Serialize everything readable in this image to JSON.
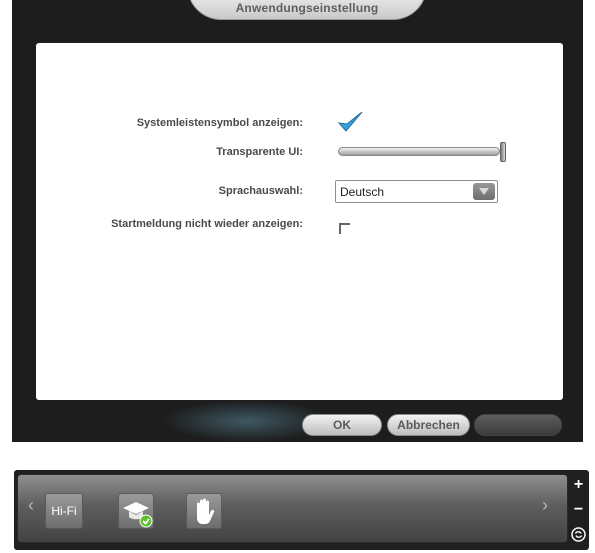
{
  "dialog": {
    "title": "Anwendungseinstellung",
    "settings": {
      "tray_icon_label": "Systemleistensymbol anzeigen:",
      "tray_icon_checked": true,
      "transparent_ui_label": "Transparente UI:",
      "transparent_ui_value": 1.0,
      "language_label": "Sprachauswahl:",
      "language_value": "Deutsch",
      "startup_msg_label": "Startmeldung nicht wieder anzeigen:",
      "startup_msg_checked": false
    },
    "buttons": {
      "ok": "OK",
      "cancel": "Abbrechen",
      "extra": ""
    }
  },
  "toolbar": {
    "prev_icon": "chevron-left-icon",
    "next_icon": "chevron-right-icon",
    "items": [
      {
        "label": "Hi-Fi",
        "icon": "hifi-icon"
      },
      {
        "label": "",
        "icon": "graduation-cap-icon"
      },
      {
        "label": "",
        "icon": "hand-icon"
      }
    ],
    "side_controls": [
      "+",
      "−"
    ]
  },
  "colors": {
    "accent_check": "#3aa0d8",
    "success_badge": "#5cc22a"
  }
}
